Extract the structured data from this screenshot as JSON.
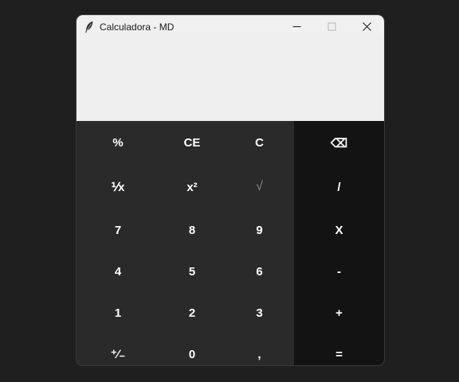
{
  "window": {
    "title": "Calculadora - MD",
    "icon": "feather-icon",
    "controls": [
      "minimize-icon",
      "maximize-icon",
      "close-icon"
    ]
  },
  "display": {
    "value": ""
  },
  "keypad": {
    "rows": [
      [
        "%",
        "CE",
        "C",
        "⌫"
      ],
      [
        "⅟x",
        "x²",
        "√",
        "/"
      ],
      [
        "7",
        "8",
        "9",
        "X"
      ],
      [
        "4",
        "5",
        "6",
        "-"
      ],
      [
        "1",
        "2",
        "3",
        "+"
      ],
      [
        "⁺∕₋",
        "0",
        ",",
        "="
      ]
    ]
  },
  "colors": {
    "window_bg": "#2a2a2a",
    "operator_column_bg": "#131313",
    "display_bg": "#efefef",
    "titlebar_bg": "#f0f0f0",
    "key_text": "#ffffff",
    "disabled_key_text": "#8a8a8a"
  }
}
